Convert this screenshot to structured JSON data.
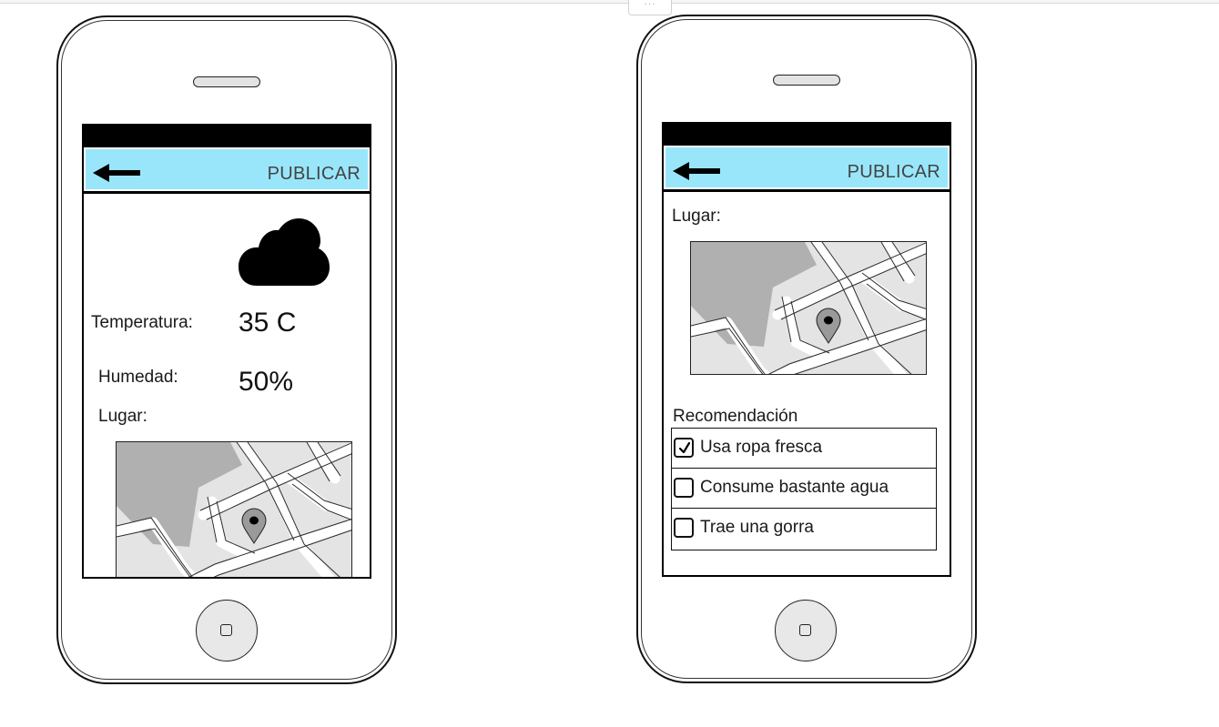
{
  "canvas": {
    "handle_label": "···"
  },
  "phones": [
    {
      "toolbar": {
        "back_icon": "arrow-left-icon",
        "publish_label": "PUBLICAR"
      },
      "weather_icon": "cloud-icon",
      "temperature": {
        "label": "Temperatura:",
        "value": "35 C"
      },
      "humidity": {
        "label": "Humedad:",
        "value": "50%"
      },
      "place": {
        "label": "Lugar:",
        "map_icon": "map-pin-icon"
      }
    },
    {
      "toolbar": {
        "back_icon": "arrow-left-icon",
        "publish_label": "PUBLICAR"
      },
      "place": {
        "label": "Lugar:",
        "map_icon": "map-pin-icon"
      },
      "recommendation": {
        "label": "Recomendación",
        "items": [
          {
            "text": "Usa ropa fresca",
            "checked": true
          },
          {
            "text": "Consume bastante agua",
            "checked": false
          },
          {
            "text": "Trae una gorra",
            "checked": false
          }
        ]
      }
    }
  ]
}
